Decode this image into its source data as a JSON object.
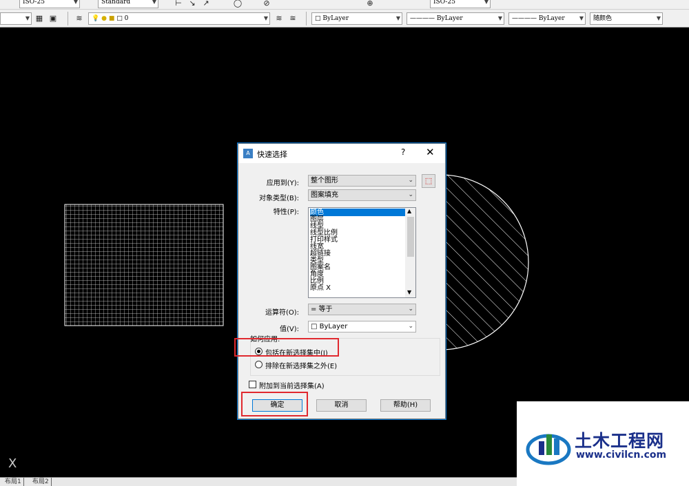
{
  "toolbar": {
    "dimstyle_value": "ISO-25",
    "textstyle_value": "Standard",
    "dimstyle2_value": "ISO-25",
    "layer_value": "0",
    "color_value": "ByLayer",
    "linetype_value": "ByLayer",
    "lineweight_value": "ByLayer",
    "plotstyle_value": "随颜色"
  },
  "dialog": {
    "title": "快速选择",
    "help_glyph": "?",
    "close_glyph": "✕",
    "apply_to_label": "应用到(Y):",
    "apply_to_value": "整个图形",
    "object_type_label": "对象类型(B):",
    "object_type_value": "图案填充",
    "properties_label": "特性(P):",
    "properties": [
      "颜色",
      "图层",
      "线型",
      "线型比例",
      "打印样式",
      "线宽",
      "超链接",
      "类型",
      "图案名",
      "角度",
      "比例",
      "原点 X"
    ],
    "operator_label": "运算符(O):",
    "operator_value": "= 等于",
    "value_label": "值(V):",
    "value_value": "ByLayer",
    "how_apply_label": "如何应用:",
    "include_label": "包括在新选择集中(I)",
    "exclude_label": "排除在新选择集之外(E)",
    "append_label": "附加到当前选择集(A)",
    "ok_label": "确定",
    "cancel_label": "取消",
    "help_label": "帮助(H)"
  },
  "status": {
    "tab_layout1": "布局1",
    "tab_layout2": "布局2",
    "axis_label": "X"
  },
  "watermark": {
    "title": "土木工程网",
    "url": "www.civilcn.com"
  },
  "colors": {
    "accent": "#0078d7",
    "highlight_red": "#e0282e",
    "watermark_blue": "#1a2f8a"
  }
}
